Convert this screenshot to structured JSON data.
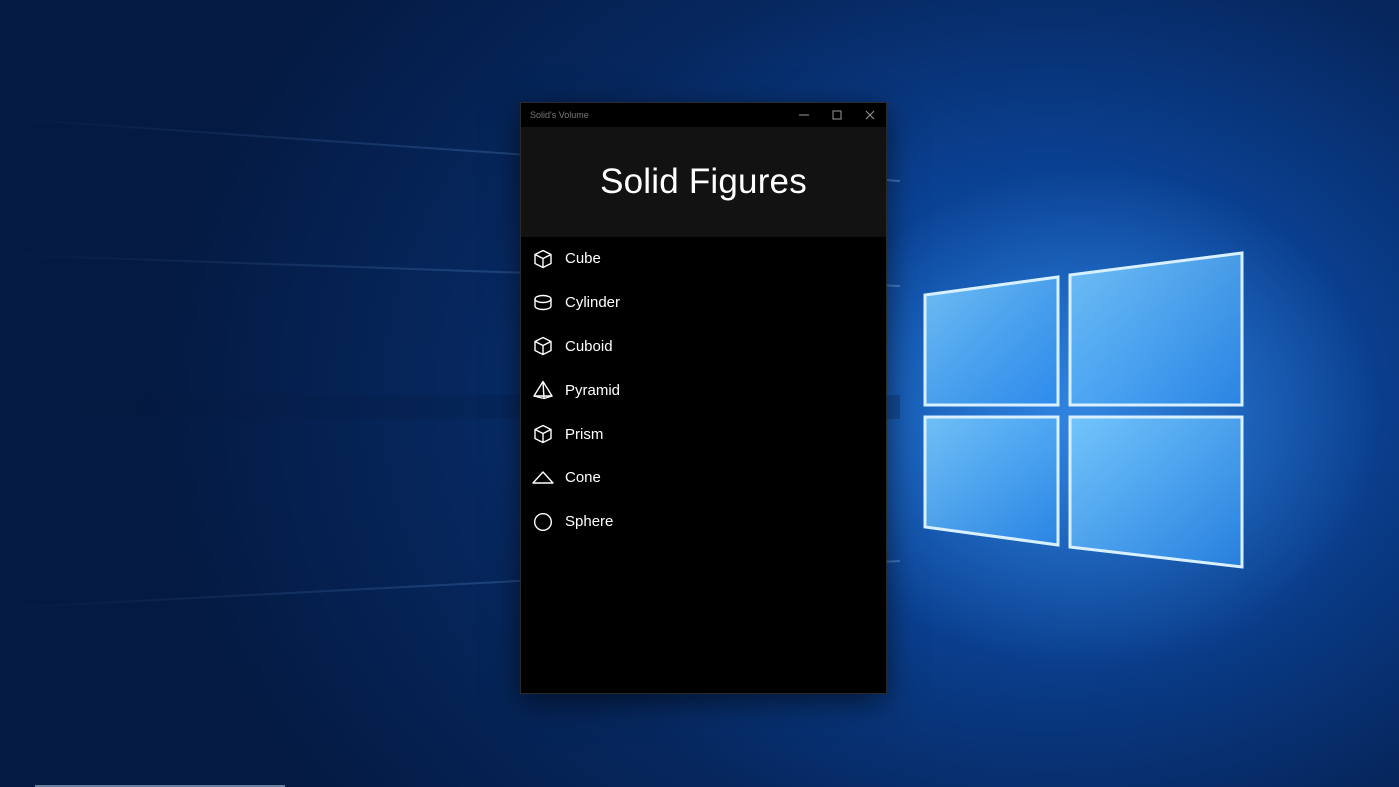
{
  "window": {
    "title": "Solid's Volume",
    "controls": {
      "minimize": "minimize-icon",
      "maximize": "maximize-icon",
      "close": "close-icon"
    }
  },
  "header": {
    "title": "Solid Figures"
  },
  "menu": {
    "items": [
      {
        "label": "Cube",
        "icon": "cube-icon"
      },
      {
        "label": "Cylinder",
        "icon": "cylinder-icon"
      },
      {
        "label": "Cuboid",
        "icon": "cuboid-icon"
      },
      {
        "label": "Pyramid",
        "icon": "pyramid-icon"
      },
      {
        "label": "Prism",
        "icon": "prism-icon"
      },
      {
        "label": "Cone",
        "icon": "cone-icon"
      },
      {
        "label": "Sphere",
        "icon": "sphere-icon"
      }
    ]
  },
  "colors": {
    "window_bg": "#000000",
    "header_bg": "#121212",
    "text": "#ffffff",
    "desktop_blue": "#0a3f8f"
  }
}
